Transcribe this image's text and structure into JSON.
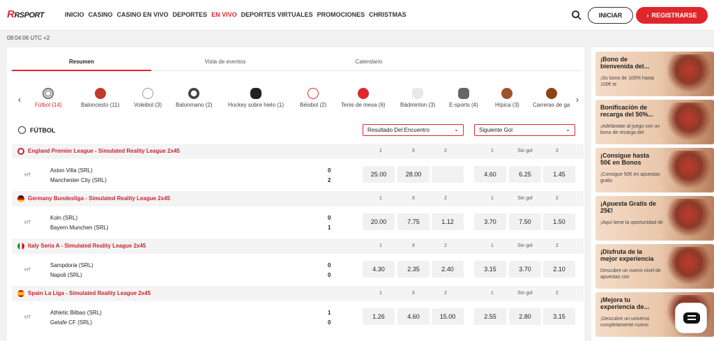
{
  "header": {
    "logo_main": "R",
    "logo_sub": "SPORT",
    "nav": [
      "INICIO",
      "CASINO",
      "CASINO EN VIVO",
      "DEPORTES",
      "EN VIVO",
      "DEPORTES VIRTUALES",
      "PROMOCIONES",
      "CHRISTMAS"
    ],
    "active_nav": "EN VIVO",
    "login_label": "INICIAR",
    "register_label": "REGISTRARSE",
    "icons": {
      "search": "search-icon",
      "register": "chevron-right-icon"
    }
  },
  "clock": "08:04:06 UTC +2",
  "tabs": [
    "Resumen",
    "Vista de eventos",
    "Calendario"
  ],
  "sports": [
    {
      "label": "Fútbol (14)",
      "icon": "soccer-ball-icon",
      "color": "#333333",
      "active": true
    },
    {
      "label": "Baloncesto (11)",
      "icon": "basketball-icon",
      "color": "#c0392b"
    },
    {
      "label": "Voleibol (3)",
      "icon": "volleyball-icon",
      "color": "#dddddd"
    },
    {
      "label": "Balonmano (2)",
      "icon": "handball-icon",
      "color": "#555555"
    },
    {
      "label": "Hockey sobre hielo (1)",
      "icon": "hockey-puck-icon",
      "color": "#222222"
    },
    {
      "label": "Béisbol (2)",
      "icon": "baseball-icon",
      "color": "#f2d6d6"
    },
    {
      "label": "Tenis de mesa (6)",
      "icon": "table-tennis-icon",
      "color": "#e0262b"
    },
    {
      "label": "Bádminton (3)",
      "icon": "shuttlecock-icon",
      "color": "#cccccc"
    },
    {
      "label": "E-sports (4)",
      "icon": "gamepad-icon",
      "color": "#666666"
    },
    {
      "label": "Hípica (3)",
      "icon": "horse-racing-icon",
      "color": "#a0522d"
    },
    {
      "label": "Carreras de ga",
      "icon": "greyhound-icon",
      "color": "#8b4513"
    }
  ],
  "section_title": "FÚTBOL",
  "market1": "Resultado Del Encuentro",
  "market2": "Siguiente Gol",
  "col_headers": {
    "m1": [
      "1",
      "X",
      "2"
    ],
    "m2": [
      "1",
      "Sin gol",
      "2"
    ]
  },
  "leagues": [
    {
      "name": "England Premier League - Simulated Reality League 2x45",
      "flag": "#c8232c",
      "match": {
        "status": "HT",
        "home": "Aston Villa (SRL)",
        "away": "Manchester City (SRL)",
        "score_home": "0",
        "score_away": "2",
        "odds1": [
          "25.00",
          "28.00",
          ""
        ],
        "odds2": [
          "4.60",
          "6.25",
          "1.45"
        ]
      }
    },
    {
      "name": "Germany Bundesliga - Simulated Reality League 2x45",
      "flag": "#222222",
      "match": {
        "status": "HT",
        "home": "Koln (SRL)",
        "away": "Bayern Munchen (SRL)",
        "score_home": "0",
        "score_away": "1",
        "odds1": [
          "20.00",
          "7.75",
          "1.12"
        ],
        "odds2": [
          "3.70",
          "7.50",
          "1.50"
        ]
      }
    },
    {
      "name": "Italy Seria A - Simulated Reality League 2x45",
      "flag": "#1e8a3c",
      "match": {
        "status": "HT",
        "home": "Sampdoria (SRL)",
        "away": "Napoli (SRL)",
        "score_home": "0",
        "score_away": "0",
        "odds1": [
          "4.30",
          "2.35",
          "2.40"
        ],
        "odds2": [
          "3.15",
          "3.70",
          "2.10"
        ]
      }
    },
    {
      "name": "Spain La Liga - Simulated Reality League 2x45",
      "flag": "#e0262b",
      "match": {
        "status": "HT",
        "home": "Athletic Bilbao (SRL)",
        "away": "Getafe CF (SRL)",
        "score_home": "1",
        "score_away": "0",
        "odds1": [
          "1.26",
          "4.60",
          "15.00"
        ],
        "odds2": [
          "2.55",
          "2.80",
          "3.15"
        ]
      }
    }
  ],
  "promos": [
    {
      "title": "¡Bono de bienvenida del...",
      "desc": "¡Su bono de 100% hasta 100€ te"
    },
    {
      "title": "Bonificación de recarga del 50%...",
      "desc": "¡Adelántate al juego con un bono de recarga del"
    },
    {
      "title": "¡Consigue hasta 50€ en Bonos",
      "desc": "¡Consigue 50€ en apuestas gratis"
    },
    {
      "title": "¡Apuesta Gratis de 25€!",
      "desc": "¡Aquí tiene la oportunidad de"
    },
    {
      "title": "¡Disfruta de la mejor experiencia",
      "desc": "Descubre un nuevo nivel de apuestas con"
    },
    {
      "title": "¡Mejora tu experiencia de...",
      "desc": "¡Descubre un universo completamente nuevo"
    }
  ],
  "chat_icon": "chat-icon"
}
